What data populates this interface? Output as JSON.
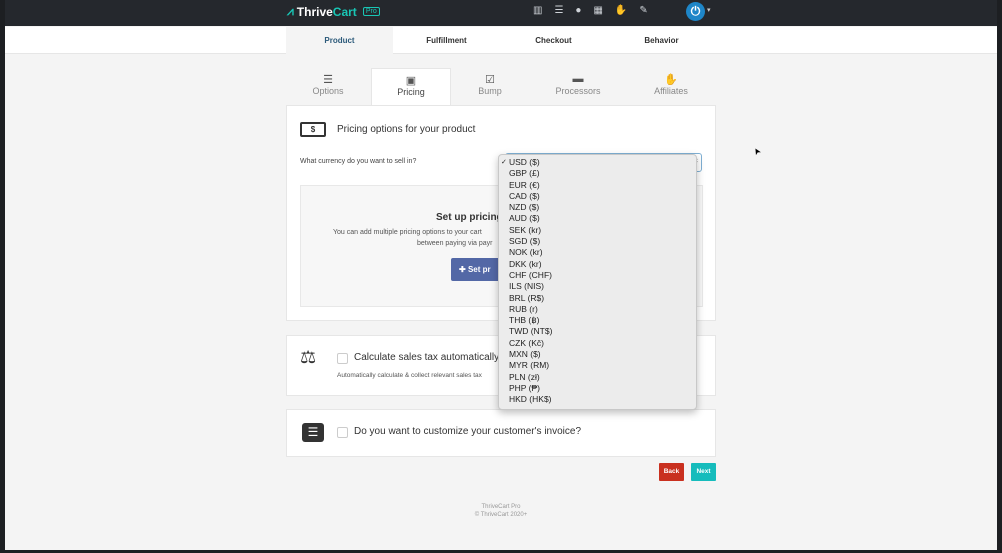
{
  "header": {
    "brand": "Thrive",
    "brand_accent": "Cart",
    "badge": "Pro",
    "icons": [
      "layout-icon",
      "list-icon",
      "user-icon",
      "calendar-icon",
      "handshake-icon",
      "edit-icon"
    ],
    "avatar": "power-icon"
  },
  "main_tabs": [
    {
      "label": "Product",
      "active": true
    },
    {
      "label": "Fulfillment"
    },
    {
      "label": "Checkout"
    },
    {
      "label": "Behavior"
    }
  ],
  "sub_tabs": [
    {
      "label": "Options",
      "icon": "sliders-icon"
    },
    {
      "label": "Pricing",
      "icon": "money-icon",
      "active": true
    },
    {
      "label": "Bump",
      "icon": "checkbox-icon"
    },
    {
      "label": "Processors",
      "icon": "credit-card-icon"
    },
    {
      "label": "Affiliates",
      "icon": "handshake-icon"
    }
  ],
  "pricing": {
    "title": "Pricing options for your product",
    "currency_label": "What currency do you want to sell in?",
    "selected": "USD ($)",
    "setup_heading": "Set up pricing f",
    "setup_text_1": "You can add multiple pricing options to your cart",
    "setup_text_2": "between paying via payr",
    "setup_button": "Set pr"
  },
  "currency_options": [
    "USD ($)",
    "GBP (£)",
    "EUR (€)",
    "CAD ($)",
    "NZD ($)",
    "AUD ($)",
    "SEK (kr)",
    "SGD ($)",
    "NOK (kr)",
    "DKK (kr)",
    "CHF (CHF)",
    "ILS (NIS)",
    "BRL (R$)",
    "RUB (r)",
    "THB (฿)",
    "TWD (NT$)",
    "CZK (Kč)",
    "MXN ($)",
    "MYR (RM)",
    "PLN (zł)",
    "PHP (₱)",
    "HKD (HK$)"
  ],
  "tax": {
    "label": "Calculate sales tax automatically?",
    "help": "Automatically calculate & collect relevant sales tax"
  },
  "invoice": {
    "label": "Do you want to customize your customer's invoice?"
  },
  "actions": {
    "back": "Back",
    "next": "Next",
    "back_color": "#c9301f",
    "next_color": "#16bcbc"
  },
  "footer": {
    "line1": "ThriveCart Pro",
    "line2": "© ThriveCart 2020+"
  }
}
